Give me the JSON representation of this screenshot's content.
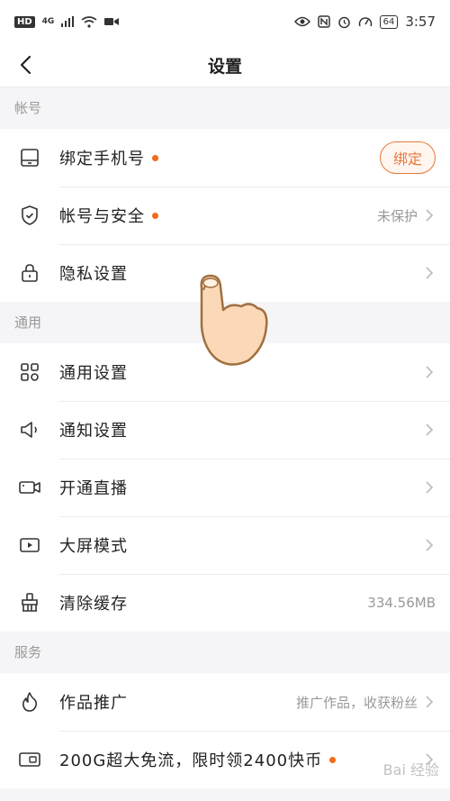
{
  "statusbar": {
    "left_badge": "HD",
    "network": "4G",
    "battery": "64",
    "time": "3:57"
  },
  "nav": {
    "title": "设置"
  },
  "sections": {
    "account": {
      "title": "帐号",
      "items": [
        {
          "label": "绑定手机号",
          "button": "绑定"
        },
        {
          "label": "帐号与安全",
          "value": "未保护"
        },
        {
          "label": "隐私设置"
        }
      ]
    },
    "general": {
      "title": "通用",
      "items": [
        {
          "label": "通用设置"
        },
        {
          "label": "通知设置"
        },
        {
          "label": "开通直播"
        },
        {
          "label": "大屏模式"
        },
        {
          "label": "清除缓存",
          "value": "334.56MB"
        }
      ]
    },
    "service": {
      "title": "服务",
      "items": [
        {
          "label": "作品推广",
          "value": "推广作品，收获粉丝"
        },
        {
          "label": "200G超大免流，限时领2400快币"
        }
      ]
    }
  },
  "watermark": "Bai 经验",
  "colors": {
    "accent": "#f26a1b",
    "bind_border": "#e8753a"
  }
}
